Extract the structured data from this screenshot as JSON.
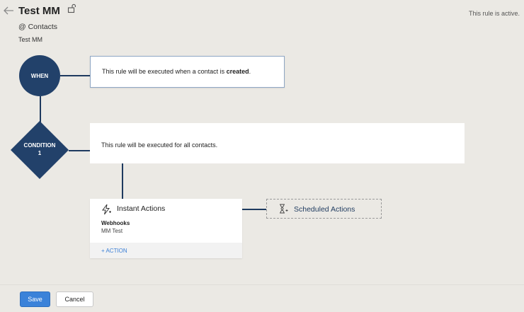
{
  "header": {
    "title": "Test MM",
    "module": "@  Contacts",
    "description": "Test MM",
    "status": "This rule is active."
  },
  "when": {
    "node_label": "WHEN",
    "text_prefix": "This rule will be executed when a contact is ",
    "text_bold": "created",
    "text_suffix": "."
  },
  "condition": {
    "node_label_line1": "CONDITION",
    "node_label_line2": "1",
    "text": "This rule will be executed for all contacts."
  },
  "instant_actions": {
    "title": "Instant Actions",
    "item_type": "Webhooks",
    "item_name": "MM Test",
    "add_label": "+ ACTION"
  },
  "scheduled_actions": {
    "title": "Scheduled Actions"
  },
  "footer": {
    "save_label": "Save",
    "cancel_label": "Cancel"
  },
  "colors": {
    "node": "#22416a",
    "connector": "#1e3a5f",
    "primary_button": "#3b82d9",
    "link": "#3b7fd6"
  },
  "icons": {
    "back": "arrow-left-icon",
    "lock": "unlock-icon",
    "instant": "lightning-icon",
    "scheduled": "hourglass-icon"
  }
}
